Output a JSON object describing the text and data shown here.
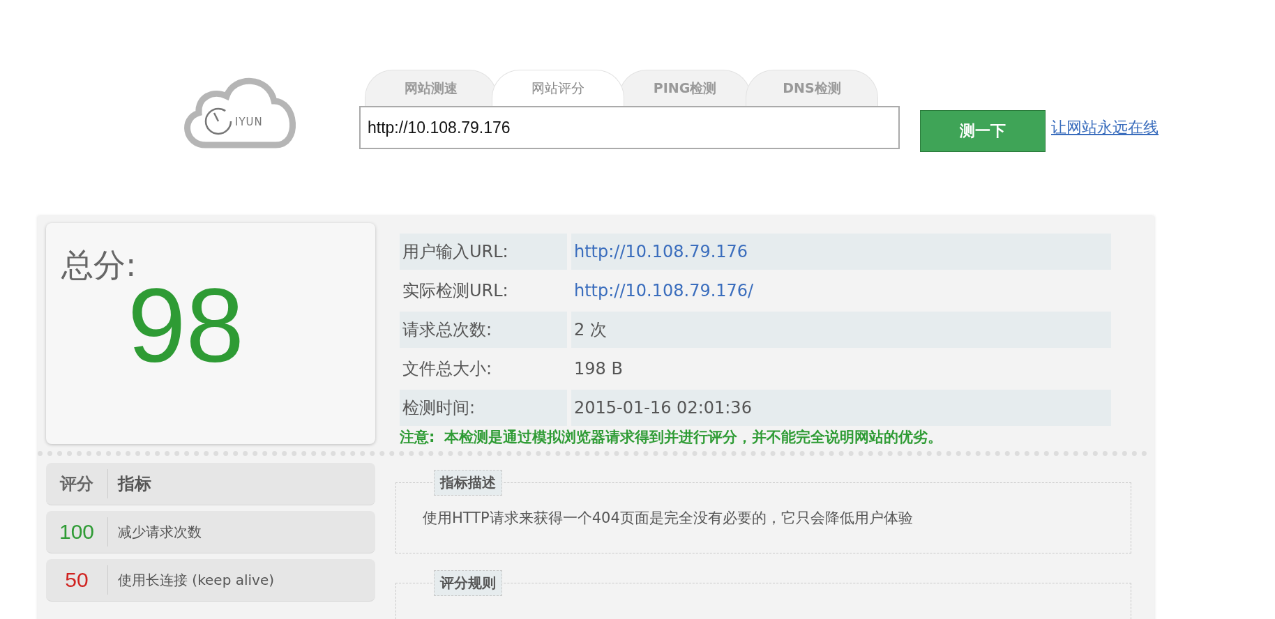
{
  "logo": {
    "text": "IYUN"
  },
  "tabs": [
    {
      "label": "网站测速",
      "selected": false
    },
    {
      "label": "网站评分",
      "selected": true
    },
    {
      "label": "PING检测",
      "selected": false
    },
    {
      "label": "DNS检测",
      "selected": false
    }
  ],
  "search": {
    "value": "http://10.108.79.176"
  },
  "test_button": "测一下",
  "promo_link": "让网站永远在线",
  "score": {
    "label": "总分:",
    "value": "98"
  },
  "info_rows": [
    {
      "label": "用户输入URL:",
      "value": "http://10.108.79.176",
      "kind": "link"
    },
    {
      "label": "实际检测URL:",
      "value": "http://10.108.79.176/",
      "kind": "link"
    },
    {
      "label": "请求总次数:",
      "value": "2 次",
      "kind": "text"
    },
    {
      "label": "文件总大小:",
      "value": "198 B",
      "kind": "text"
    },
    {
      "label": "检测时间:",
      "value": "2015-01-16 02:01:36",
      "kind": "text"
    }
  ],
  "note": {
    "label": "注意:",
    "text": "本检测是通过模拟浏览器请求得到并进行评分，并不能完全说明网站的优劣。"
  },
  "metrics": {
    "columns": [
      "评分",
      "指标"
    ],
    "rows": [
      {
        "score": "100",
        "name": "减少请求次数",
        "color": "#2e9b34",
        "selected": false
      },
      {
        "score": "50",
        "name": "使用长连接 (keep alive)",
        "color": "#d0221f",
        "selected": false
      }
    ]
  },
  "description": {
    "title": "指标描述",
    "text": "使用HTTP请求来获得一个404页面是完全没有必要的，它只会降低用户体验"
  },
  "rules": {
    "title": "评分规则"
  }
}
